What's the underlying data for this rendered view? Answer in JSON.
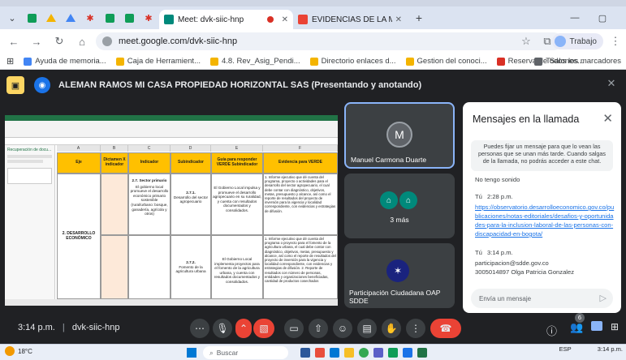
{
  "browser": {
    "tabs": [
      {
        "label": "Meet: dvk-siic-hnp",
        "active": true
      },
      {
        "label": "EVIDENCIAS DE LA MATRIZ HE",
        "active": false
      }
    ],
    "new_tab": "+",
    "url": "meet.google.com/dvk-siic-hnp",
    "profile_label": "Trabajo",
    "bookmarks": [
      "Ayuda de memoria...",
      "Caja de Herramient...",
      "4.8. Rev_Asig_Pendi...",
      "Directorio enlaces d...",
      "Gestion del conoci...",
      "Reserva de Salones..."
    ],
    "all_bookmarks": "Todos los marcadores"
  },
  "meet": {
    "presenter_title": "ALEMAN RAMOS MI CASA PROPIEDAD HORIZONTAL SAS (Presentando y anotando)",
    "meeting_time": "3:14 p.m.",
    "meeting_separator": "|",
    "meeting_code": "dvk-siic-hnp",
    "participants_badge": "6",
    "tiles": [
      {
        "name": "Manuel Carmona Duarte",
        "initial": "M"
      },
      {
        "name": "3 más"
      },
      {
        "name": "Participación Ciudadana OAP SDDE"
      }
    ]
  },
  "sheet": {
    "columns": [
      "A",
      "B",
      "C",
      "D",
      "E",
      "F"
    ],
    "headers": [
      "Eje",
      "Dictamen X indicador",
      "Indicador",
      "Subindicador",
      "Guía para responder VERDE Subindicador",
      "Evidencia para VERDE"
    ],
    "eje": "2. DESARROLLO ECONÓMICO",
    "indicador_title": "2.7. Sector primario",
    "indicador_desc": "El gobierno local promueve el desarrollo económico primario sostenible (rural/urbano: bosque, ganadería, agrícola y otros)",
    "sub1_code": "2.7.1.",
    "sub1_desc": "Desarrollo del sector agropecuario",
    "sub2_code": "2.7.2.",
    "sub2_desc": "Fomento de la agricultura urbana",
    "guide1": "El Gobierno Local impulsa y promueve el desarrollo agropecuario en su ruralidad, y cuenta con resultados documentados y consolidados.",
    "guide2": "El Gobierno Local implementa proyectos para el fomento de la agricultura urbana, y cuenta con resultados documentados y consolidados.",
    "evidence1": "1. Informe ejecutivo que dé cuenta del programa, proyecto o actividades para el desarrollo del sector agropecuario, el cual debe contar con diagnóstico, objetivos, metas, presupuesto y alcance, así como el reporte de resultados del proyecto de inversión para la vigencia y localidad correspondiente, con evidencias y estrategias de difusión.",
    "evidence2": "1. Informe ejecutivo que dé cuenta del programa o proyecto para el fomento de la agricultura urbana, el cual debe contar con diagnóstico, objetivos, metas, presupuesto y alcance, así como el reporte de resultados del proyecto de inversión para la vigencia y localidad correspondiente, con evidencias y estrategias de difusión. 2. Reporte de resultados con número de personas, entidades y organizaciones beneficiadas, cantidad de productos cosechados",
    "side_title": "Recuperación de docu..."
  },
  "chat": {
    "title": "Mensajes en la llamada",
    "note": "Puedes fijar un mensaje para que lo vean las personas que se unan más tarde. Cuando salgas de la llamada, no podrás acceder a este chat.",
    "messages": [
      {
        "text": "No tengo sonido"
      },
      {
        "sender": "Tú",
        "time": "2:28 p.m.",
        "link": "https://observatorio.desarrolloeconomico.gov.co/publicaciones/notas-editoriales/desafios-y-oportunidades-para-la-inclusion-laboral-de-las-personas-con-discapacidad-en-bogota/"
      },
      {
        "sender": "Tú",
        "time": "3:14 p.m.",
        "line1": "participacion@sdde.gov.co",
        "line2": "3005014897 Olga Patricia Gonzalez"
      }
    ],
    "input_placeholder": "Envía un mensaje"
  },
  "taskbar": {
    "temperature": "18°C",
    "search_label": "Buscar",
    "language": "ESP",
    "clock": "3:14 p.m."
  },
  "colors": {
    "meet_bg": "#202124",
    "chat_link": "#1a73e8",
    "hangup_red": "#ea4335",
    "sheet_header": "#ffc000",
    "excel_green": "#217346"
  }
}
